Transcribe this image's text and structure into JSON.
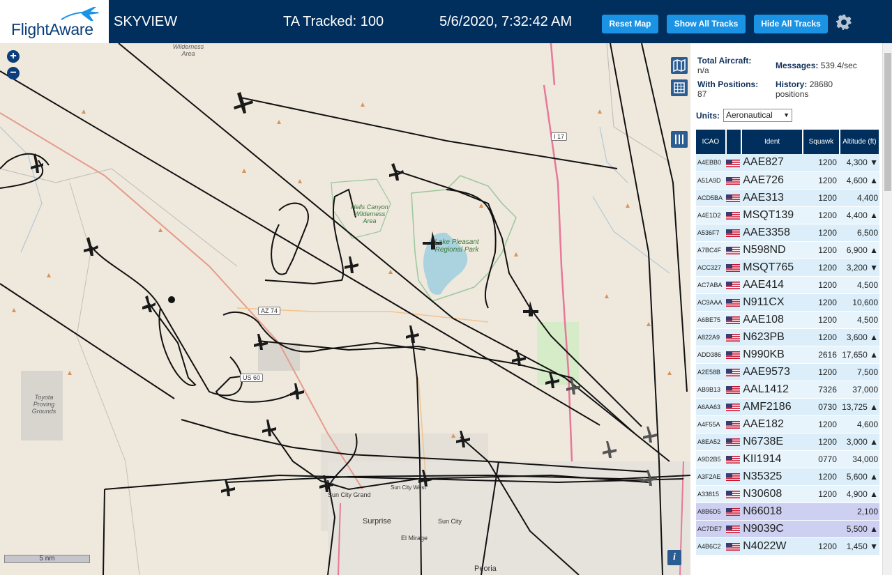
{
  "header": {
    "logo_text": "FlightAware",
    "app_title": "SKYVIEW",
    "tracked": "TA Tracked: 100",
    "clock": "5/6/2020, 7:32:42 AM",
    "reset_label": "Reset Map",
    "show_label": "Show All Tracks",
    "hide_label": "Hide All Tracks"
  },
  "map": {
    "scale_label": "5 nm",
    "labels": {
      "wilderness1": "Wilderness Area",
      "hells_canyon": "Hells Canyon Wilderness Area",
      "lake_pleasant": "Lake Pleasant Regional Park",
      "toyota": "Toyota Proving Grounds",
      "surprise": "Surprise",
      "sun_city_grand": "Sun City Grand",
      "sun_city": "Sun City",
      "el_mirage": "El Mirage",
      "sun_city_west": "Sun City West",
      "peoria": "Peoria"
    },
    "shields": {
      "az74": "AZ 74",
      "us60": "US 60",
      "i17": "I 17"
    }
  },
  "panel": {
    "total_label": "Total Aircraft:",
    "total_value": "n/a",
    "messages_label": "Messages:",
    "messages_value": "539.4/sec",
    "positions_label": "With Positions:",
    "positions_value": "87",
    "history_label": "History:",
    "history_value": "28680 positions",
    "units_label": "Units:",
    "units_value": "Aeronautical"
  },
  "table": {
    "headers": {
      "icao": "ICAO",
      "ident": "Ident",
      "squawk": "Squawk",
      "altitude": "Altitude (ft)"
    },
    "rows": [
      {
        "icao": "A4EBB0",
        "ident": "AAE827",
        "squawk": "1200",
        "alt": "4,300 ▼",
        "nopos": false
      },
      {
        "icao": "A51A9D",
        "ident": "AAE726",
        "squawk": "1200",
        "alt": "4,600 ▲",
        "nopos": false
      },
      {
        "icao": "ACD5BA",
        "ident": "AAE313",
        "squawk": "1200",
        "alt": "4,400",
        "nopos": false
      },
      {
        "icao": "A4E1D2",
        "ident": "MSQT139",
        "squawk": "1200",
        "alt": "4,400 ▲",
        "nopos": false
      },
      {
        "icao": "A536F7",
        "ident": "AAE3358",
        "squawk": "1200",
        "alt": "6,500",
        "nopos": false
      },
      {
        "icao": "A7BC4F",
        "ident": "N598ND",
        "squawk": "1200",
        "alt": "6,900 ▲",
        "nopos": false
      },
      {
        "icao": "ACC327",
        "ident": "MSQT765",
        "squawk": "1200",
        "alt": "3,200 ▼",
        "nopos": false
      },
      {
        "icao": "AC7ABA",
        "ident": "AAE414",
        "squawk": "1200",
        "alt": "4,500",
        "nopos": false
      },
      {
        "icao": "AC9AAA",
        "ident": "N911CX",
        "squawk": "1200",
        "alt": "10,600",
        "nopos": false
      },
      {
        "icao": "A6BE75",
        "ident": "AAE108",
        "squawk": "1200",
        "alt": "4,500",
        "nopos": false
      },
      {
        "icao": "A822A9",
        "ident": "N623PB",
        "squawk": "1200",
        "alt": "3,600 ▲",
        "nopos": false
      },
      {
        "icao": "ADD386",
        "ident": "N990KB",
        "squawk": "2616",
        "alt": "17,650 ▲",
        "nopos": false
      },
      {
        "icao": "A2E58B",
        "ident": "AAE9573",
        "squawk": "1200",
        "alt": "7,500",
        "nopos": false
      },
      {
        "icao": "AB9B13",
        "ident": "AAL1412",
        "squawk": "7326",
        "alt": "37,000",
        "nopos": false
      },
      {
        "icao": "A6AA63",
        "ident": "AMF2186",
        "squawk": "0730",
        "alt": "13,725 ▲",
        "nopos": false
      },
      {
        "icao": "A4F55A",
        "ident": "AAE182",
        "squawk": "1200",
        "alt": "4,600",
        "nopos": false
      },
      {
        "icao": "A8EA52",
        "ident": "N6738E",
        "squawk": "1200",
        "alt": "3,000 ▲",
        "nopos": false
      },
      {
        "icao": "A9D2B5",
        "ident": "KII1914",
        "squawk": "0770",
        "alt": "34,000",
        "nopos": false
      },
      {
        "icao": "A3F2AE",
        "ident": "N35325",
        "squawk": "1200",
        "alt": "5,600 ▲",
        "nopos": false
      },
      {
        "icao": "A33815",
        "ident": "N30608",
        "squawk": "1200",
        "alt": "4,900 ▲",
        "nopos": false
      },
      {
        "icao": "A8B6D5",
        "ident": "N66018",
        "squawk": "",
        "alt": "2,100",
        "nopos": true
      },
      {
        "icao": "AC7DE7",
        "ident": "N9039C",
        "squawk": "",
        "alt": "5,500 ▲",
        "nopos": true
      },
      {
        "icao": "A4B6C2",
        "ident": "N4022W",
        "squawk": "1200",
        "alt": "1,450 ▼",
        "nopos": false
      }
    ]
  },
  "colors": {
    "header_bg": "#002f5d",
    "button": "#1b93e4",
    "row_bg": "#dbeef9",
    "nopos_bg": "#cdd0f0"
  }
}
